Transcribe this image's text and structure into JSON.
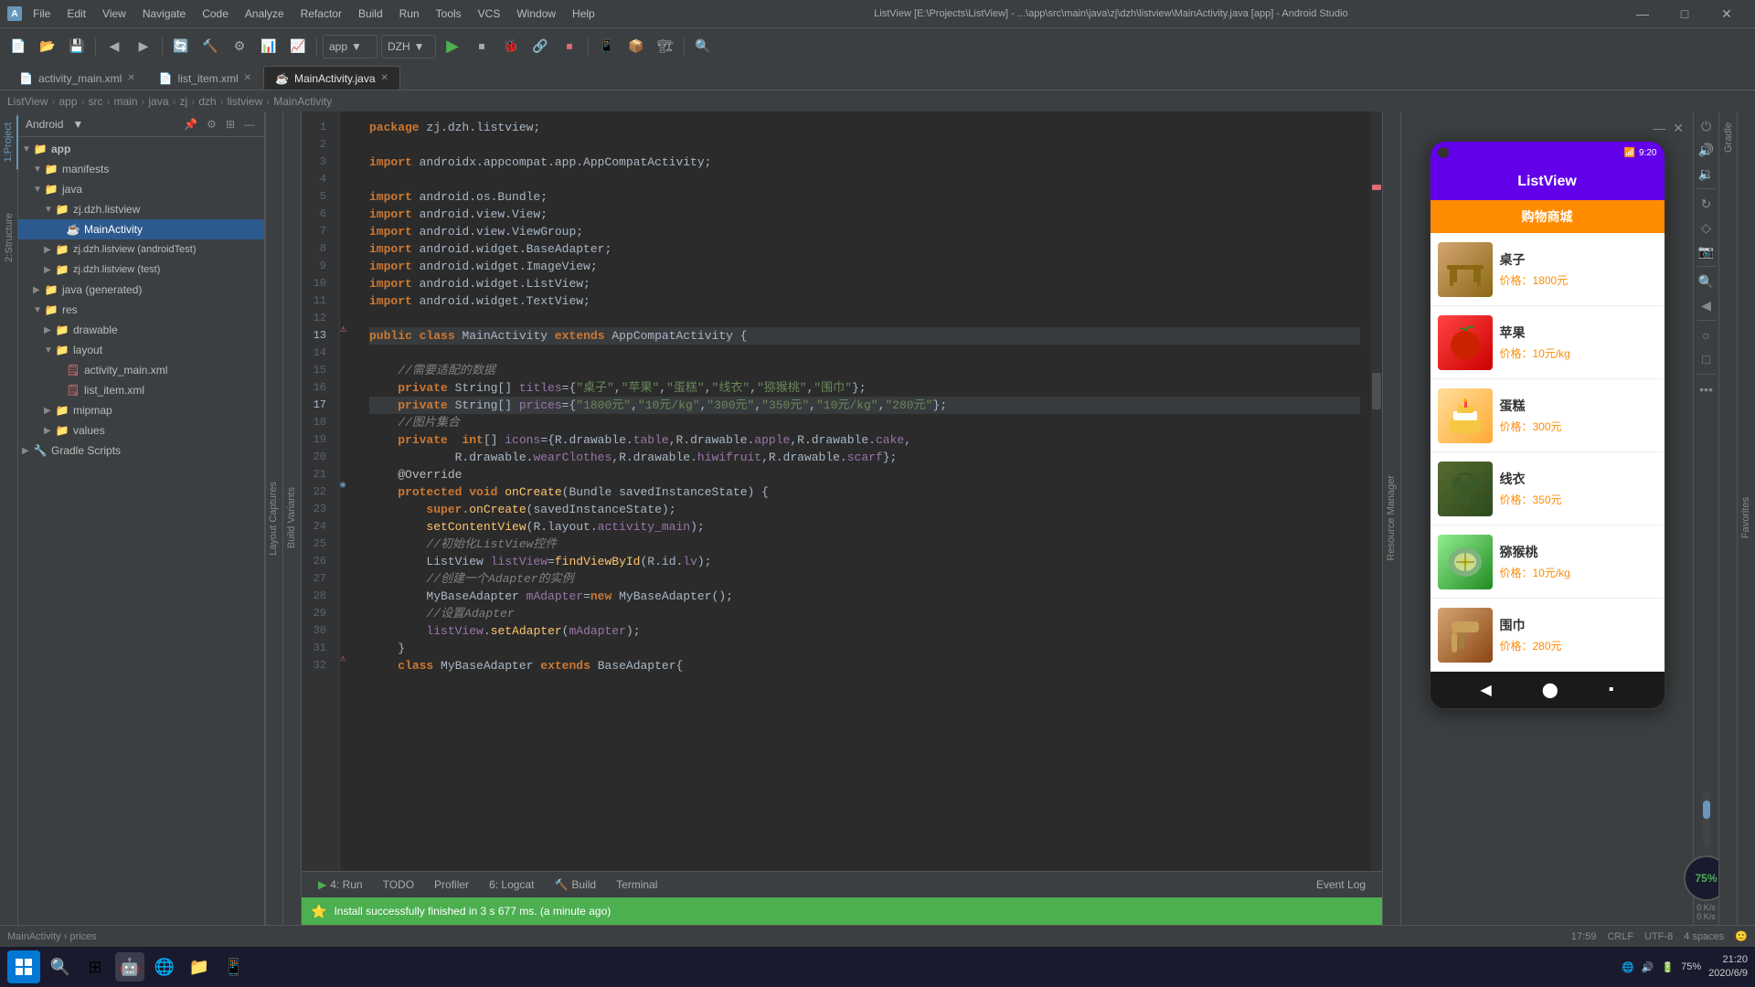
{
  "titleBar": {
    "title": "ListView [E:\\Projects\\ListView] - ...\\app\\src\\main\\java\\zj\\dzh\\listview\\MainActivity.java [app] - Android Studio",
    "minLabel": "—",
    "maxLabel": "□",
    "closeLabel": "✕"
  },
  "menuBar": {
    "items": [
      "File",
      "Edit",
      "View",
      "Navigate",
      "Code",
      "Analyze",
      "Refactor",
      "Build",
      "Run",
      "Tools",
      "VCS",
      "Window",
      "Help"
    ]
  },
  "toolbar": {
    "appName": "app",
    "configName": "DZH"
  },
  "breadcrumb": {
    "items": [
      "ListView",
      "app",
      "src",
      "main",
      "java",
      "zj",
      "dzh",
      "listview",
      "MainActivity"
    ]
  },
  "tabs": {
    "items": [
      {
        "label": "activity_main.xml",
        "active": false
      },
      {
        "label": "list_item.xml",
        "active": false
      },
      {
        "label": "MainActivity.java",
        "active": true
      }
    ]
  },
  "projectPanel": {
    "title": "Android",
    "tree": [
      {
        "indent": 0,
        "arrow": "▼",
        "icon": "📁",
        "label": "app",
        "type": "folder"
      },
      {
        "indent": 1,
        "arrow": "▼",
        "icon": "📁",
        "label": "manifests",
        "type": "folder"
      },
      {
        "indent": 1,
        "arrow": "▼",
        "icon": "📁",
        "label": "java",
        "type": "folder"
      },
      {
        "indent": 2,
        "arrow": "▼",
        "icon": "📁",
        "label": "zj.dzh.listview",
        "type": "folder"
      },
      {
        "indent": 3,
        "arrow": "",
        "icon": "☕",
        "label": "MainActivity",
        "type": "java",
        "selected": true
      },
      {
        "indent": 2,
        "arrow": "▶",
        "icon": "📁",
        "label": "zj.dzh.listview (androidTest)",
        "type": "folder"
      },
      {
        "indent": 2,
        "arrow": "▶",
        "icon": "📁",
        "label": "zj.dzh.listview (test)",
        "type": "folder"
      },
      {
        "indent": 1,
        "arrow": "▶",
        "icon": "📁",
        "label": "java (generated)",
        "type": "folder"
      },
      {
        "indent": 1,
        "arrow": "▼",
        "icon": "📁",
        "label": "res",
        "type": "folder"
      },
      {
        "indent": 2,
        "arrow": "▶",
        "icon": "📁",
        "label": "drawable",
        "type": "folder"
      },
      {
        "indent": 2,
        "arrow": "▼",
        "icon": "📁",
        "label": "layout",
        "type": "folder"
      },
      {
        "indent": 3,
        "arrow": "",
        "icon": "🗒",
        "label": "activity_main.xml",
        "type": "xml"
      },
      {
        "indent": 3,
        "arrow": "",
        "icon": "🗒",
        "label": "list_item.xml",
        "type": "xml"
      },
      {
        "indent": 2,
        "arrow": "▶",
        "icon": "📁",
        "label": "mipmap",
        "type": "folder"
      },
      {
        "indent": 2,
        "arrow": "▶",
        "icon": "📁",
        "label": "values",
        "type": "folder"
      },
      {
        "indent": 0,
        "arrow": "▶",
        "icon": "📁",
        "label": "Gradle Scripts",
        "type": "folder"
      }
    ]
  },
  "codeLines": [
    {
      "num": 1,
      "code": "package zj.dzh.listview;"
    },
    {
      "num": 2,
      "code": ""
    },
    {
      "num": 3,
      "code": "import androidx.appcompat.app.AppCompatActivity;"
    },
    {
      "num": 4,
      "code": ""
    },
    {
      "num": 5,
      "code": "import android.os.Bundle;"
    },
    {
      "num": 6,
      "code": "import android.view.View;"
    },
    {
      "num": 7,
      "code": "import android.view.ViewGroup;"
    },
    {
      "num": 8,
      "code": "import android.widget.BaseAdapter;"
    },
    {
      "num": 9,
      "code": "import android.widget.ImageView;"
    },
    {
      "num": 10,
      "code": "import android.widget.ListView;"
    },
    {
      "num": 11,
      "code": "import android.widget.TextView;"
    },
    {
      "num": 12,
      "code": ""
    },
    {
      "num": 13,
      "code": "public class MainActivity extends AppCompatActivity {",
      "highlight": true
    },
    {
      "num": 14,
      "code": ""
    },
    {
      "num": 15,
      "code": "    //需要适配的数据"
    },
    {
      "num": 16,
      "code": "    private String[] titles={\"桌子\",\"苹果\",\"蛋糕\",\"线衣\",\"猕猴桃\",\"围巾\"};"
    },
    {
      "num": 17,
      "code": "    private String[] prices={\"1800元\",\"10元/kg\",\"300元\",\"350元\",\"10元/kg\",\"280元\"};",
      "highlight": true
    },
    {
      "num": 18,
      "code": "    //图片集合"
    },
    {
      "num": 19,
      "code": "    private  int[] icons={R.drawable.table,R.drawable.apple,R.drawable.cake,"
    },
    {
      "num": 20,
      "code": "            R.drawable.wearClothes,R.drawable.hiwifruit,R.drawable.scarf};"
    },
    {
      "num": 21,
      "code": "    @Override"
    },
    {
      "num": 22,
      "code": "    protected void onCreate(Bundle savedInstanceState) {"
    },
    {
      "num": 23,
      "code": "        super.onCreate(savedInstanceState);"
    },
    {
      "num": 24,
      "code": "        setContentView(R.layout.activity_main);"
    },
    {
      "num": 25,
      "code": "        //初始化ListView控件"
    },
    {
      "num": 26,
      "code": "        ListView listView=findViewById(R.id.lv);"
    },
    {
      "num": 27,
      "code": "        //创建一个Adapter的实例"
    },
    {
      "num": 28,
      "code": "        MyBaseAdapter mAdapter=new MyBaseAdapter();"
    },
    {
      "num": 29,
      "code": "        //设置Adapter"
    },
    {
      "num": 30,
      "code": "        listView.setAdapter(mAdapter);"
    },
    {
      "num": 31,
      "code": "    }"
    },
    {
      "num": 32,
      "code": "    class MyBaseAdapter extends BaseAdapter{"
    }
  ],
  "bottomTabs": [
    {
      "label": "4: Run",
      "icon": "▶",
      "active": false
    },
    {
      "label": "TODO",
      "active": false
    },
    {
      "label": "Profiler",
      "active": false
    },
    {
      "label": "6: Logcat",
      "active": false
    },
    {
      "label": "Build",
      "active": false
    },
    {
      "label": "Terminal",
      "active": false
    }
  ],
  "notification": {
    "text": "Install successfully finished in 3 s 677 ms. (a minute ago)"
  },
  "statusBar": {
    "breadcrumb": "MainActivity › prices",
    "line": "17:59",
    "lineEnding": "CRLF",
    "encoding": "UTF-8",
    "indent": "4 spaces",
    "emoji": "🙂"
  },
  "taskbar": {
    "time": "21:20",
    "date": "2020/6/9",
    "network": "⚡",
    "battery": "75%"
  },
  "phone": {
    "title": "ListView",
    "orangeBarText": "购物商城",
    "time": "9:20",
    "items": [
      {
        "name": "桌子",
        "price": "价格：1800元",
        "imgClass": "img-table",
        "emoji": "🪑"
      },
      {
        "name": "苹果",
        "price": "价格：10元/kg",
        "imgClass": "img-apple",
        "emoji": "🍎"
      },
      {
        "name": "蛋糕",
        "price": "价格：300元",
        "imgClass": "img-cake",
        "emoji": "🎂"
      },
      {
        "name": "线衣",
        "price": "价格：350元",
        "imgClass": "img-sweater",
        "emoji": "🧥"
      },
      {
        "name": "猕猴桃",
        "price": "价格：10元/kg",
        "imgClass": "img-kiwi",
        "emoji": "🥝"
      },
      {
        "name": "围巾",
        "price": "价格：280元",
        "imgClass": "img-scarf",
        "emoji": "🧣"
      }
    ]
  },
  "gradlePanel": {
    "label": "Gradle"
  },
  "sideLabels": {
    "project": "1:Project",
    "structure": "2:Structure",
    "captures": "Layout Captures",
    "buildVariants": "Build Variants",
    "resourceManager": "Resource Manager",
    "favorites": "Favorites"
  }
}
